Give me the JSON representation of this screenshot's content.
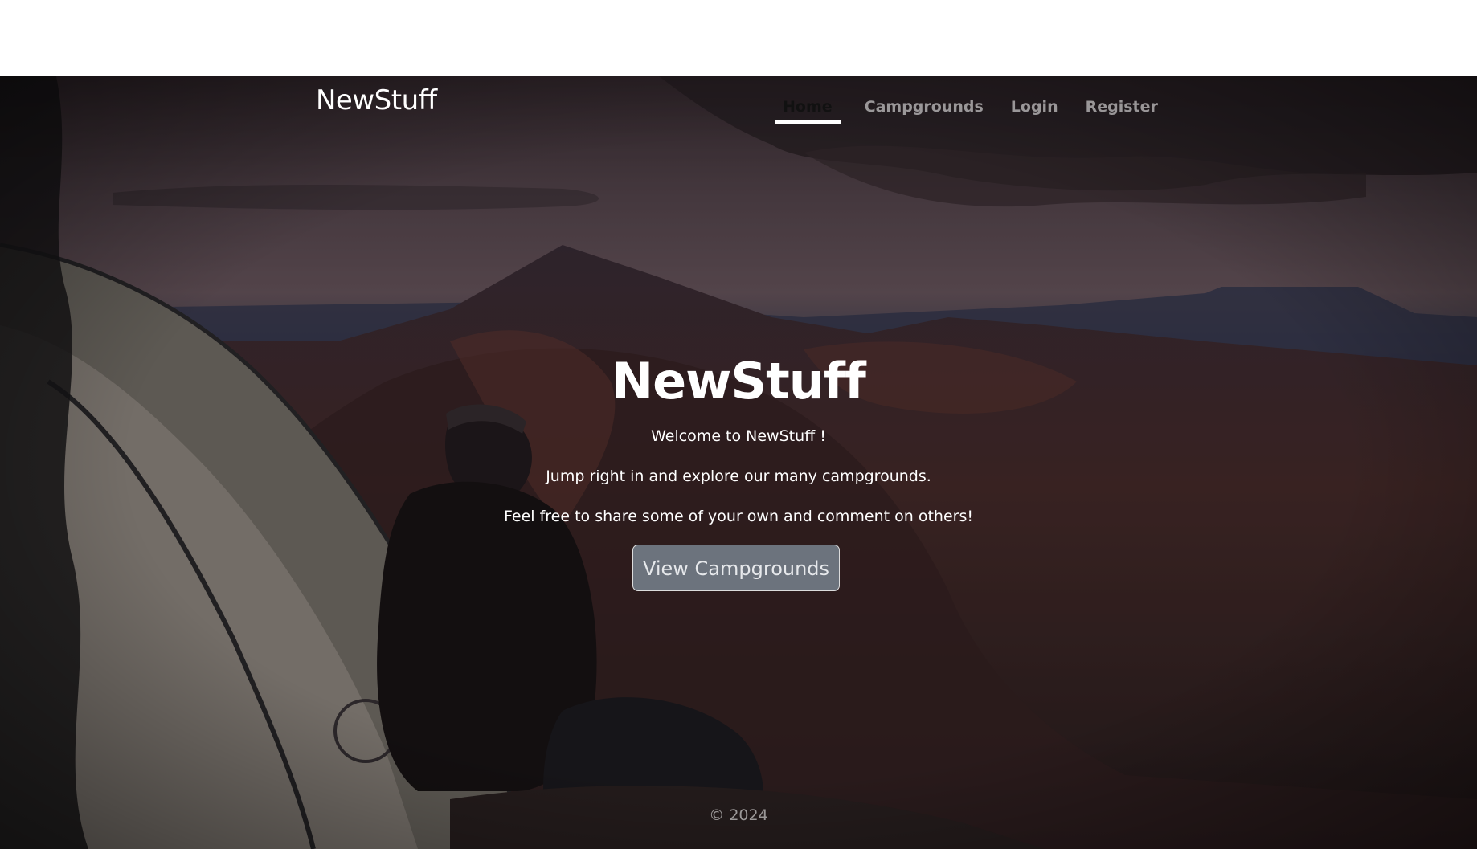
{
  "navbar": {
    "brand": "NewStuff",
    "links": [
      {
        "label": "Home",
        "active": true
      },
      {
        "label": "Campgrounds",
        "active": false
      },
      {
        "label": "Login",
        "active": false
      },
      {
        "label": "Register",
        "active": false
      }
    ]
  },
  "hero": {
    "title": "NewStuff",
    "lines": [
      "Welcome to NewStuff !",
      "Jump right in and explore our many campgrounds.",
      "Feel free to share some of your own and comment on others!"
    ],
    "button_label": "View Campgrounds"
  },
  "footer": {
    "text": "© 2024"
  },
  "colors": {
    "button_bg": "#6c737d",
    "active_underline": "#ffffff"
  }
}
